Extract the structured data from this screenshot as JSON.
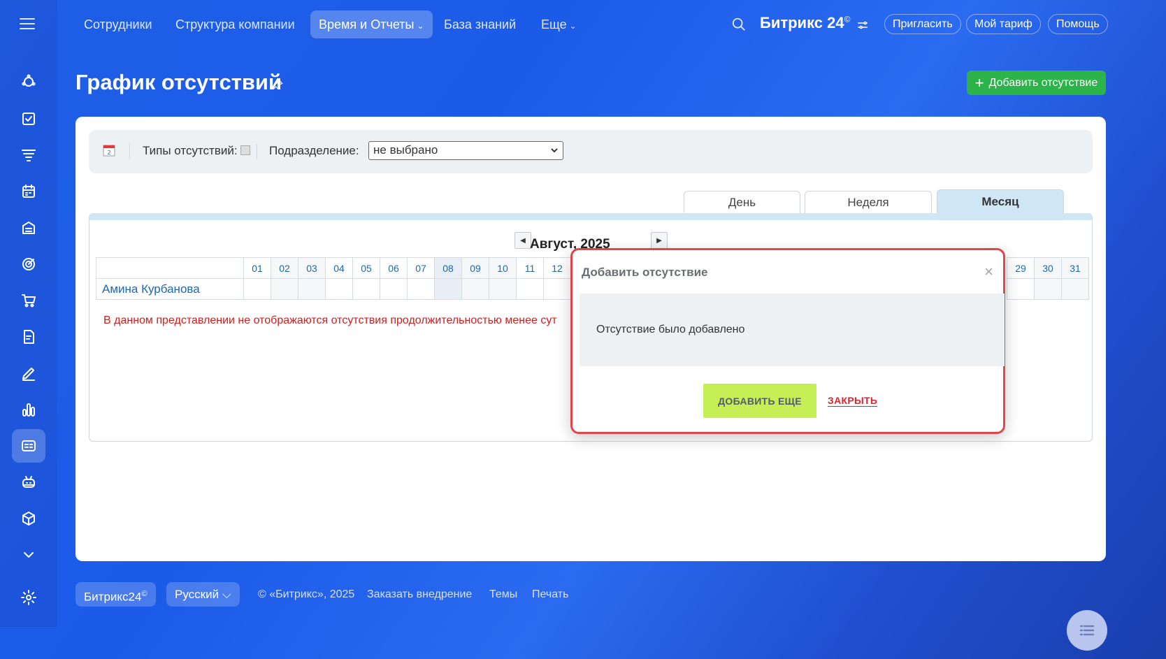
{
  "nav": {
    "items": [
      {
        "label": "Сотрудники"
      },
      {
        "label": "Структура компании"
      },
      {
        "label": "Время и Отчеты",
        "chev": "⌄"
      },
      {
        "label": "База знаний"
      },
      {
        "label": "Еще",
        "chev": "⌄"
      }
    ],
    "brand": "Битрикс 24",
    "brand_mark": "©",
    "invite": "Пригласить",
    "tariff": "Мой тариф",
    "help": "Помощь"
  },
  "sidebar": {
    "icons": [
      "menu-icon",
      "feed-icon",
      "tasks-icon",
      "crm-funnel-icon",
      "calendar-icon",
      "store-icon",
      "target-icon",
      "cart-icon",
      "documents-icon",
      "signature-icon",
      "analytics-icon",
      "time-reports-icon",
      "robot-icon",
      "box-icon",
      "chevron-down-icon",
      "gear-icon"
    ],
    "active": "time-reports-icon"
  },
  "page": {
    "title": "График отсутствий",
    "add_button": "Добавить отсутствие"
  },
  "filter": {
    "types_label": "Типы отсутствий:",
    "dept_label": "Подразделение:",
    "dept_value": "не выбрано"
  },
  "tabs": {
    "day": "День",
    "week": "Неделя",
    "month": "Месяц",
    "active": "month"
  },
  "calendar": {
    "month_title": "Август, 2025",
    "days_left": [
      "01",
      "02",
      "03",
      "04",
      "05",
      "06",
      "07",
      "08",
      "09",
      "10",
      "11",
      "12"
    ],
    "days_right": [
      "29",
      "30",
      "31"
    ],
    "highlighted_day": "08",
    "employee": "Амина Курбанова",
    "warning": "В данном представлении не отображаются отсутствия продолжительностью менее сут"
  },
  "popup": {
    "title": "Добавить отсутствие",
    "message": "Отсутствие было добавлено",
    "add_more": "ДОБАВИТЬ ЕЩЕ",
    "close": "ЗАКРЫТЬ"
  },
  "footer": {
    "brand": "Битрикс24",
    "brand_mark": "©",
    "language": "Русский",
    "copyright": "© «Битрикс», 2025",
    "order": "Заказать внедрение",
    "themes": "Темы",
    "print": "Печать"
  },
  "colors": {
    "accent_green": "#2cb34a",
    "popup_border": "#e0464d",
    "add_more_bg": "#c6ef55",
    "warning_text": "#d21d1d"
  }
}
